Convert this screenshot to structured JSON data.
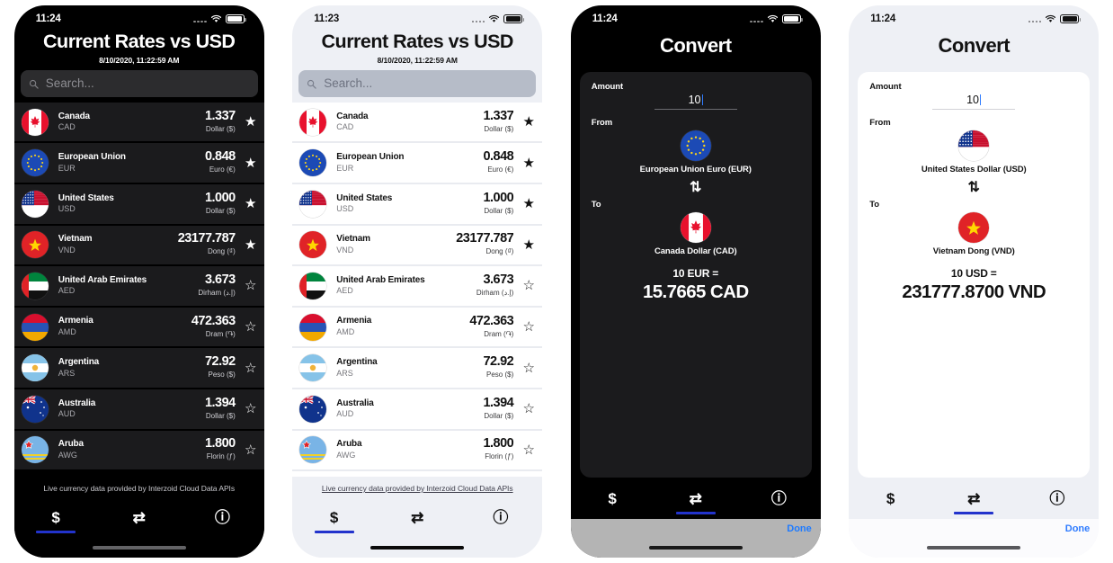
{
  "screens": [
    {
      "id": "rates-dark",
      "theme": "dark",
      "statusbar": {
        "time": "11:24"
      },
      "header": {
        "title": "Current Rates vs USD",
        "timestamp": "8/10/2020, 11:22:59 AM"
      },
      "search": {
        "placeholder": "Search..."
      },
      "rows": [
        {
          "country": "Canada",
          "code": "CAD",
          "rate": "1.337",
          "unit": "Dollar ($)",
          "starred": true,
          "flag": "ca"
        },
        {
          "country": "European Union",
          "code": "EUR",
          "rate": "0.848",
          "unit": "Euro (€)",
          "starred": true,
          "flag": "eu"
        },
        {
          "country": "United States",
          "code": "USD",
          "rate": "1.000",
          "unit": "Dollar ($)",
          "starred": true,
          "flag": "us"
        },
        {
          "country": "Vietnam",
          "code": "VND",
          "rate": "23177.787",
          "unit": "Dong (₫)",
          "starred": true,
          "flag": "vn"
        },
        {
          "country": "United Arab Emirates",
          "code": "AED",
          "rate": "3.673",
          "unit": "Dirham (إ.د)",
          "starred": false,
          "flag": "ae"
        },
        {
          "country": "Armenia",
          "code": "AMD",
          "rate": "472.363",
          "unit": "Dram (֏)",
          "starred": false,
          "flag": "am"
        },
        {
          "country": "Argentina",
          "code": "ARS",
          "rate": "72.92",
          "unit": "Peso ($)",
          "starred": false,
          "flag": "ar"
        },
        {
          "country": "Australia",
          "code": "AUD",
          "rate": "1.394",
          "unit": "Dollar ($)",
          "starred": false,
          "flag": "au"
        },
        {
          "country": "Aruba",
          "code": "AWG",
          "rate": "1.800",
          "unit": "Florin (ƒ)",
          "starred": false,
          "flag": "aw"
        }
      ],
      "footnote": "Live currency data provided by Interzoid Cloud Data APIs",
      "tabs": [
        {
          "icon": "$",
          "name": "rates",
          "active": true
        },
        {
          "icon": "⇄",
          "name": "convert",
          "active": false
        },
        {
          "icon": "ⓘ",
          "name": "info",
          "active": false
        }
      ]
    },
    {
      "id": "rates-light",
      "theme": "light",
      "statusbar": {
        "time": "11:23"
      },
      "header": {
        "title": "Current Rates vs USD",
        "timestamp": "8/10/2020, 11:22:59 AM"
      },
      "search": {
        "placeholder": "Search..."
      },
      "rows": [
        {
          "country": "Canada",
          "code": "CAD",
          "rate": "1.337",
          "unit": "Dollar ($)",
          "starred": true,
          "flag": "ca"
        },
        {
          "country": "European Union",
          "code": "EUR",
          "rate": "0.848",
          "unit": "Euro (€)",
          "starred": true,
          "flag": "eu"
        },
        {
          "country": "United States",
          "code": "USD",
          "rate": "1.000",
          "unit": "Dollar ($)",
          "starred": true,
          "flag": "us"
        },
        {
          "country": "Vietnam",
          "code": "VND",
          "rate": "23177.787",
          "unit": "Dong (₫)",
          "starred": true,
          "flag": "vn"
        },
        {
          "country": "United Arab Emirates",
          "code": "AED",
          "rate": "3.673",
          "unit": "Dirham (إ.د)",
          "starred": false,
          "flag": "ae"
        },
        {
          "country": "Armenia",
          "code": "AMD",
          "rate": "472.363",
          "unit": "Dram (֏)",
          "starred": false,
          "flag": "am"
        },
        {
          "country": "Argentina",
          "code": "ARS",
          "rate": "72.92",
          "unit": "Peso ($)",
          "starred": false,
          "flag": "ar"
        },
        {
          "country": "Australia",
          "code": "AUD",
          "rate": "1.394",
          "unit": "Dollar ($)",
          "starred": false,
          "flag": "au"
        },
        {
          "country": "Aruba",
          "code": "AWG",
          "rate": "1.800",
          "unit": "Florin (ƒ)",
          "starred": false,
          "flag": "aw"
        }
      ],
      "footnote": "Live currency data provided by Interzoid Cloud Data APIs",
      "tabs": [
        {
          "icon": "$",
          "name": "rates",
          "active": true
        },
        {
          "icon": "⇄",
          "name": "convert",
          "active": false
        },
        {
          "icon": "ⓘ",
          "name": "info",
          "active": false
        }
      ]
    },
    {
      "id": "convert-dark",
      "theme": "dark",
      "statusbar": {
        "time": "11:24"
      },
      "header": {
        "title": "Convert"
      },
      "amount": {
        "label": "Amount",
        "value": "10"
      },
      "from": {
        "label": "From",
        "currency": "European Union Euro (EUR)",
        "flag": "eu"
      },
      "swap_icon": "⇅",
      "to": {
        "label": "To",
        "currency": "Canada Dollar (CAD)",
        "flag": "ca"
      },
      "result": {
        "equation": "10 EUR =",
        "value": "15.7665 CAD"
      },
      "accessory": {
        "done_label": "Done"
      },
      "tabs": [
        {
          "icon": "$",
          "name": "rates",
          "active": false
        },
        {
          "icon": "⇄",
          "name": "convert",
          "active": true
        },
        {
          "icon": "ⓘ",
          "name": "info",
          "active": false
        }
      ]
    },
    {
      "id": "convert-light",
      "theme": "light",
      "statusbar": {
        "time": "11:24"
      },
      "header": {
        "title": "Convert"
      },
      "amount": {
        "label": "Amount",
        "value": "10"
      },
      "from": {
        "label": "From",
        "currency": "United States Dollar (USD)",
        "flag": "us"
      },
      "swap_icon": "⇅",
      "to": {
        "label": "To",
        "currency": "Vietnam Dong (VND)",
        "flag": "vn"
      },
      "result": {
        "equation": "10 USD =",
        "value": "231777.8700 VND"
      },
      "accessory": {
        "done_label": "Done"
      },
      "tabs": [
        {
          "icon": "$",
          "name": "rates",
          "active": false
        },
        {
          "icon": "⇄",
          "name": "convert",
          "active": true
        },
        {
          "icon": "ⓘ",
          "name": "info",
          "active": false
        }
      ]
    }
  ],
  "colors": {
    "accent_blue": "#2233cc",
    "done_blue": "#2f7cff",
    "dark_bg": "#000000",
    "dark_card": "#1b1b1d",
    "light_bg": "#eef0f5",
    "light_card": "#ffffff"
  },
  "icons": {
    "search": "search-icon",
    "star_filled": "★",
    "star_outline": "☆"
  }
}
